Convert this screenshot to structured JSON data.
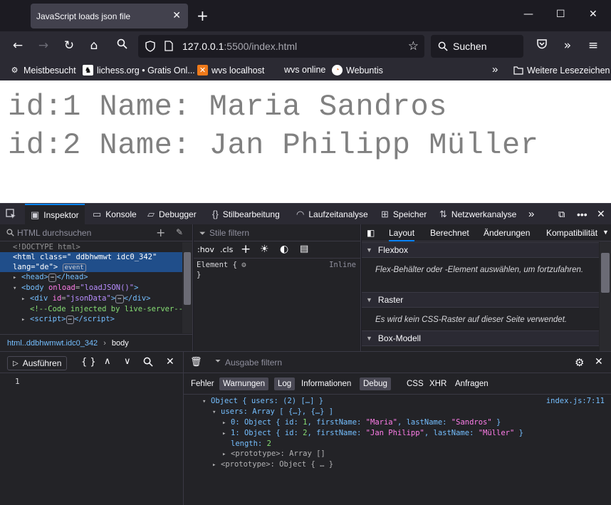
{
  "browser": {
    "tab_title": "JavaScript loads json file",
    "url_host": "127.0.0.1",
    "url_rest": ":5500/index.html",
    "search_label": "Suchen",
    "bookmarks": [
      "Meistbesucht",
      "lichess.org • Gratis Onl...",
      "wvs localhost",
      "wvs online",
      "Webuntis"
    ],
    "other_bookmarks": "Weitere Lesezeichen"
  },
  "page": {
    "users": [
      "id:1 Name: Maria Sandros",
      "id:2 Name: Jan Philipp Müller"
    ]
  },
  "devtools": {
    "tabs": [
      "Inspektor",
      "Konsole",
      "Debugger",
      "Stilbearbeitung",
      "Laufzeitanalyse",
      "Speicher",
      "Netzwerkanalyse"
    ],
    "inspector": {
      "search_placeholder": "HTML durchsuchen",
      "breadcrumb": [
        "html..ddbhwmwt.idc0_342",
        "body"
      ],
      "event_badge": "event"
    },
    "rules": {
      "filter_placeholder": "Stile filtern",
      "hov": ":hov",
      "cls": ".cls",
      "element_label": "Element {",
      "inline_label": "Inline",
      "close_brace": "}"
    },
    "layout": {
      "tabs": [
        "Layout",
        "Berechnet",
        "Änderungen",
        "Kompatibilität"
      ],
      "sections": [
        {
          "title": "Flexbox",
          "body": "Flex-Behälter oder -Element auswählen, um fortzufahren."
        },
        {
          "title": "Raster",
          "body": "Es wird kein CSS-Raster auf dieser Seite verwendet."
        },
        {
          "title": "Box-Modell",
          "body": ""
        }
      ]
    },
    "console": {
      "run_label": "Ausführen",
      "editor_line": "1",
      "filter_placeholder": "Ausgabe filtern",
      "levels": [
        "Fehler",
        "Warnungen",
        "Log",
        "Informationen",
        "Debug"
      ],
      "types": [
        "CSS",
        "XHR",
        "Anfragen"
      ],
      "source": "index.js:7:11"
    }
  }
}
